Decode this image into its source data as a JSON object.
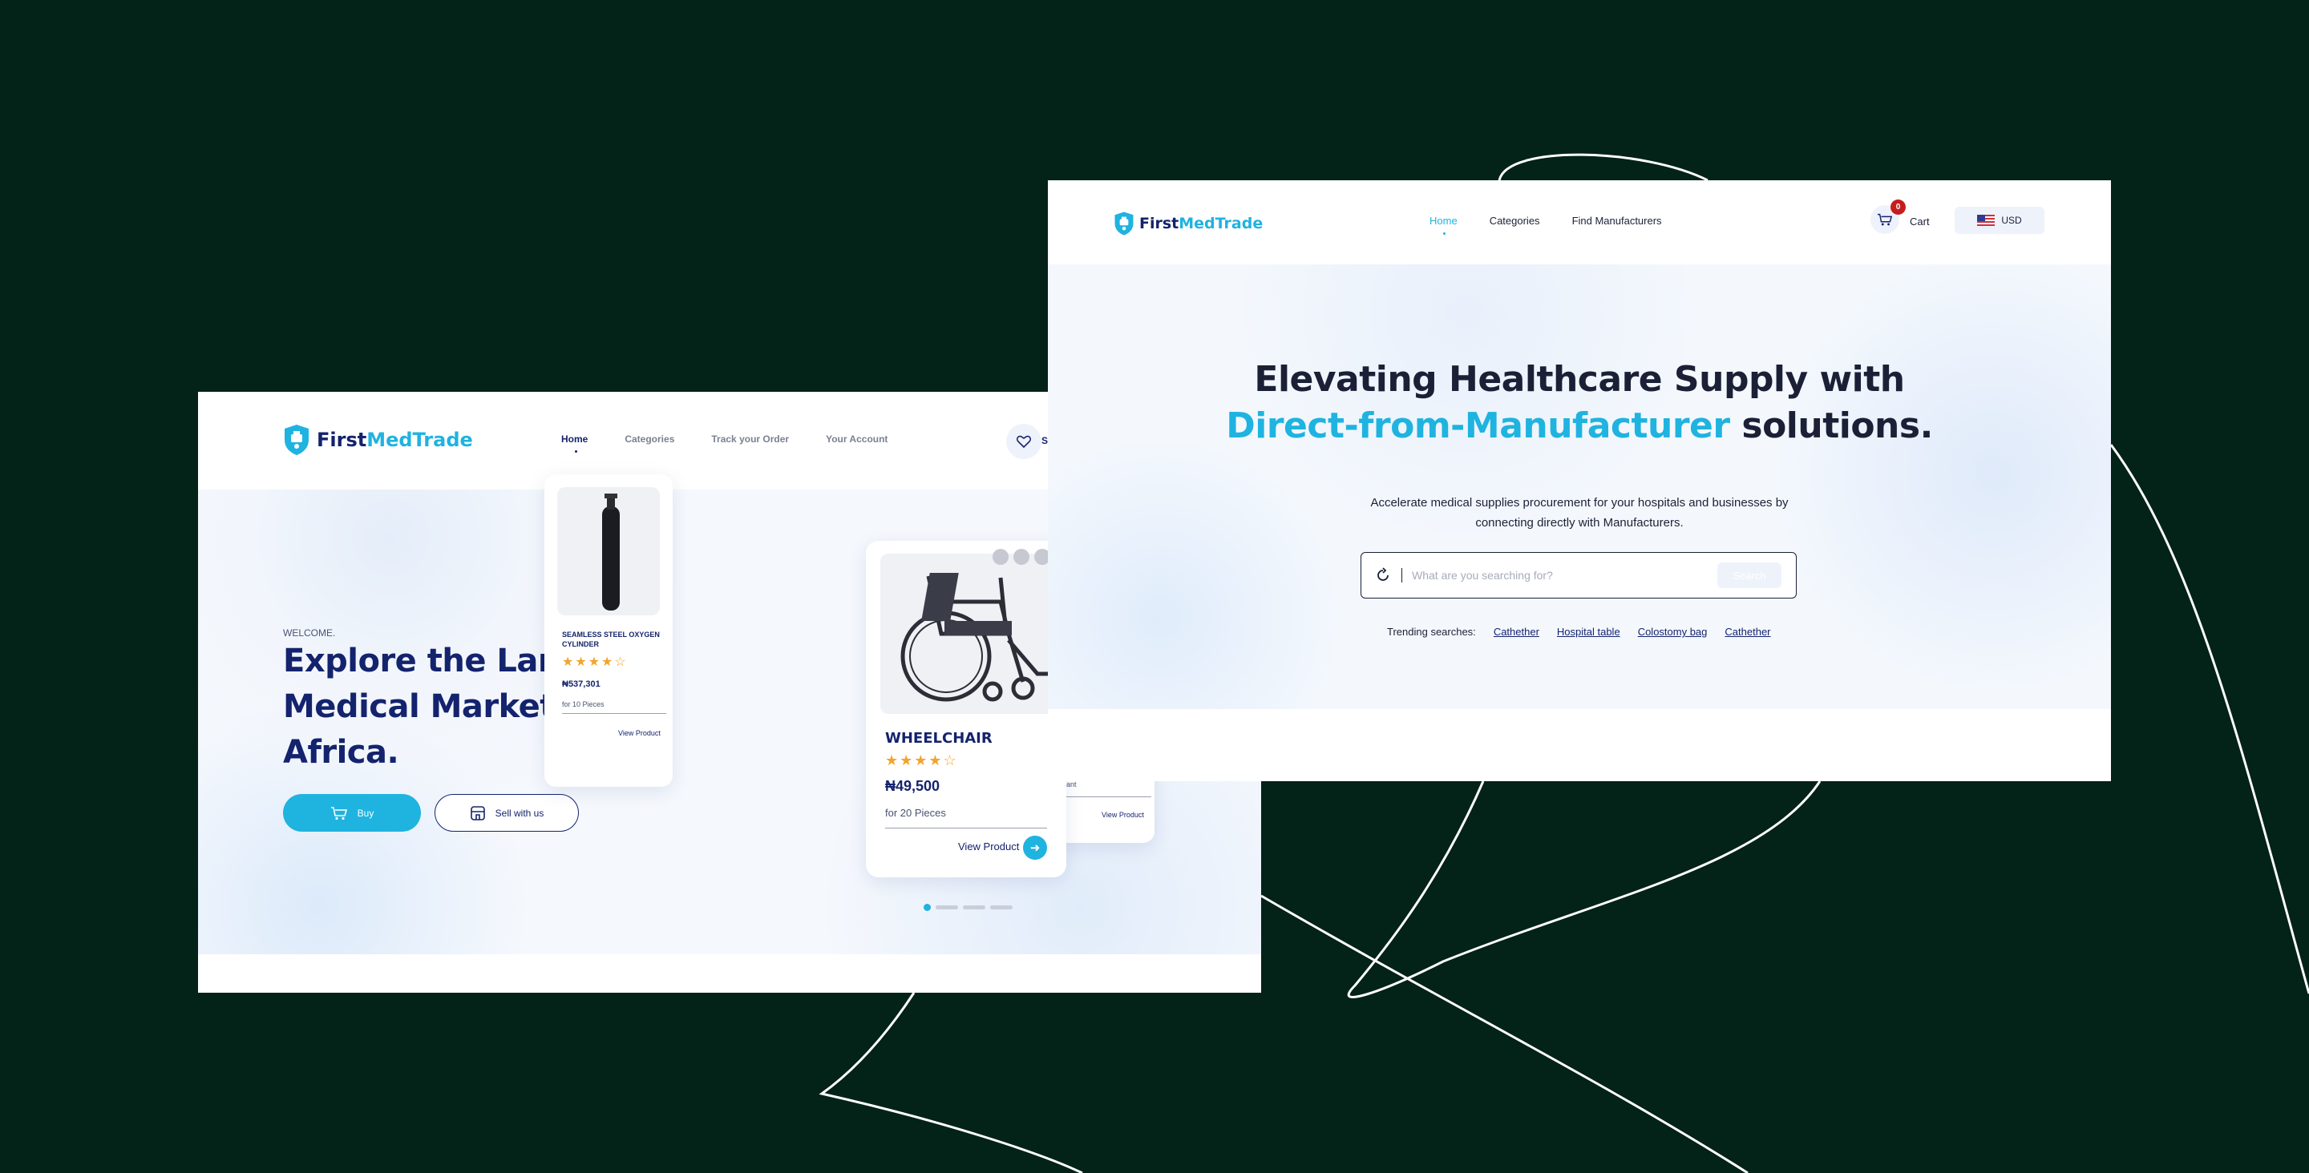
{
  "brand": {
    "name_part1": "First",
    "name_part2": "MedTrade",
    "primary": "#14236d",
    "accent": "#1fb3e0",
    "background": "#032218"
  },
  "left_screen": {
    "nav": {
      "home": "Home",
      "categories": "Categories",
      "track": "Track your Order",
      "account": "Your Account"
    },
    "wishlist_label": "S",
    "hero": {
      "welcome": "WELCOME.",
      "headline": "Explore the Largest Medical Market in Africa.",
      "buy_label": "Buy",
      "sell_label": "Sell with us"
    },
    "cards": {
      "back": {
        "title": "SEAMLESS STEEL OXYGEN CYLINDER",
        "rating": 4,
        "price": "₦537,301",
        "qty": "for 10 Pieces",
        "link": "View Product"
      },
      "front": {
        "title": "WHEELCHAIR",
        "rating": 4,
        "price": "₦49,500",
        "qty": "for 20 Pieces",
        "link": "View Product"
      },
      "side": {
        "qty_partial": "ant",
        "link": "View Product"
      }
    },
    "carousel": {
      "active_index": 0,
      "count": 4
    }
  },
  "right_screen": {
    "nav": {
      "home": "Home",
      "categories": "Categories",
      "manufacturers": "Find Manufacturers"
    },
    "cart": {
      "count": "0",
      "label": "Cart"
    },
    "currency": "USD",
    "hero": {
      "headline_line1": "Elevating Healthcare Supply with",
      "headline_accent": "Direct-from-Manufacturer",
      "headline_rest": " solutions.",
      "subtitle_line1": "Accelerate medical supplies procurement for your hospitals and businesses by",
      "subtitle_line2": "connecting directly with Manufacturers."
    },
    "search": {
      "placeholder": "What are you searching for?",
      "button": "Search"
    },
    "trending": {
      "label": "Trending searches:",
      "items": [
        "Cathether",
        "Hospital table",
        "Colostomy bag",
        "Cathether"
      ]
    }
  }
}
